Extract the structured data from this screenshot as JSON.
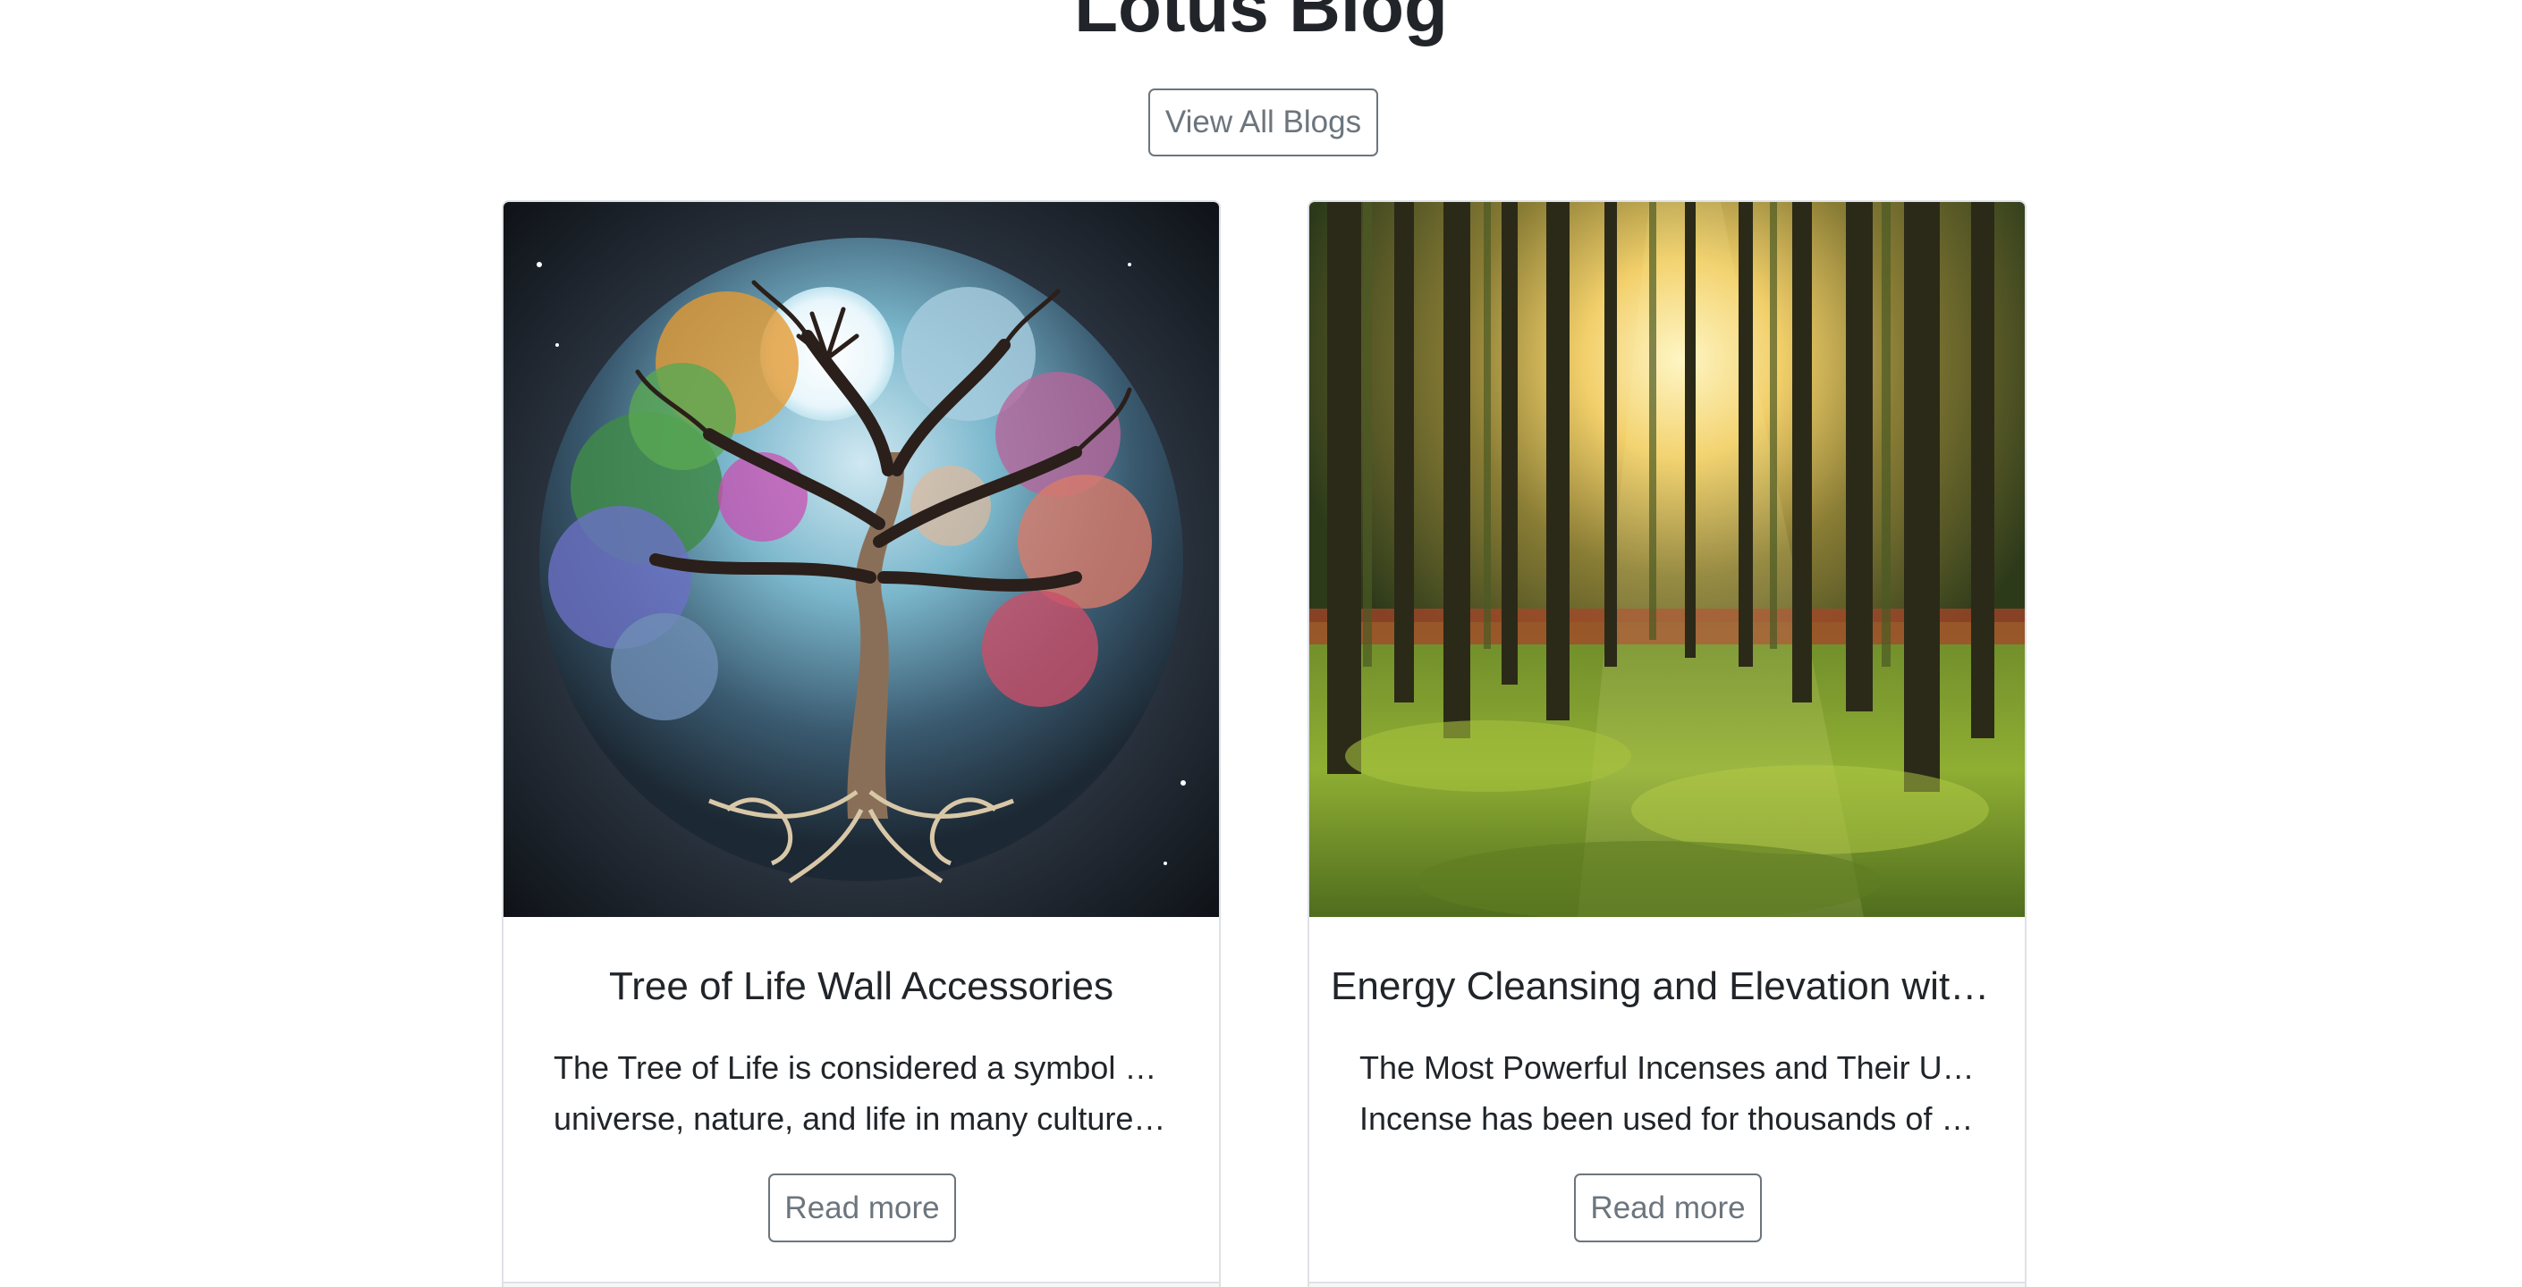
{
  "page": {
    "title": "Lotus Blog",
    "view_all_label": "View All Blogs"
  },
  "posts": [
    {
      "title": "Tree of Life Wall Accessories",
      "excerpt_lines": [
        "The Tree of Life is considered a symbol of the",
        "universe, nature, and life in many cultures. This..."
      ],
      "read_more_label": "Read more",
      "image": "tree-of-life-artwork"
    },
    {
      "title": "Energy Cleansing and Elevation with...",
      "excerpt_lines": [
        "The Most Powerful Incenses and Their Uses",
        "Incense has been used for thousands of years f..."
      ],
      "read_more_label": "Read more",
      "image": "sunlit-forest-photo"
    }
  ],
  "colors": {
    "button_border": "#6c757d",
    "card_border": "#dee2e6",
    "heading": "#212529"
  }
}
